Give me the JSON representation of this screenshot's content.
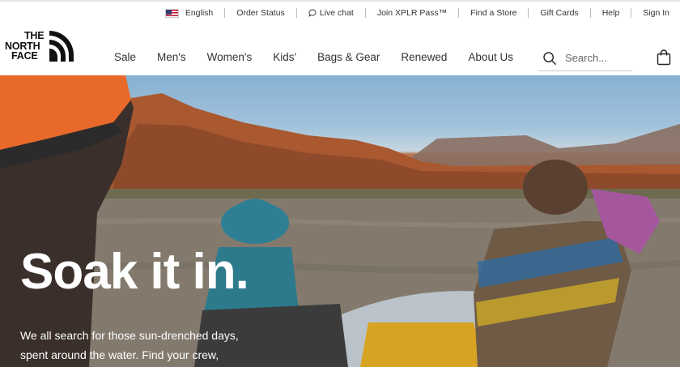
{
  "utility_bar": {
    "language": "English",
    "order_status": "Order Status",
    "live_chat": "Live chat",
    "xplr": "Join XPLR Pass™",
    "find_store": "Find a Store",
    "gift_cards": "Gift Cards",
    "help": "Help",
    "sign_in": "Sign In"
  },
  "logo": {
    "line1": "THE",
    "line2": "NORTH",
    "line3": "FACE"
  },
  "nav": {
    "items": [
      "Sale",
      "Men's",
      "Women's",
      "Kids'",
      "Bags & Gear",
      "Renewed",
      "About Us"
    ]
  },
  "search": {
    "placeholder": "Search..."
  },
  "hero": {
    "title": "Soak it in.",
    "copy_line1": "We all search for those sun-drenched days,",
    "copy_line2": "spent around the water. Find your crew,"
  },
  "colors": {
    "flag_red": "#c8102e",
    "flag_blue": "#3c3b6e",
    "sky": "#86b0d2",
    "cliff": "#9a5536",
    "river": "#7c7466",
    "raft": "#b9c3c9",
    "teal_hat": "#2e7f93",
    "orange_cap": "#e8692a"
  },
  "icons": [
    "us-flag-icon",
    "chat-bubble-icon",
    "search-icon",
    "shopping-bag-icon"
  ]
}
